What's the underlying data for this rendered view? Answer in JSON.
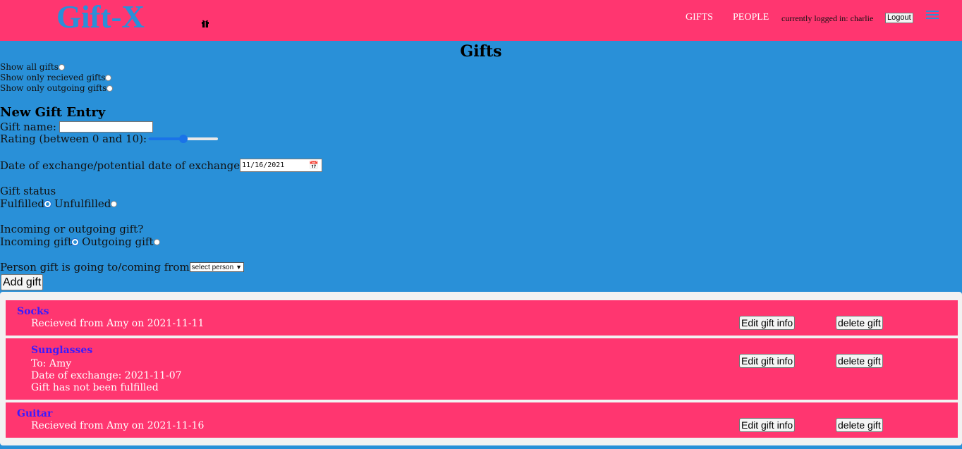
{
  "nav": {
    "brand": "Gift-X",
    "gifts_label": "GIFTS",
    "people_label": "PEOPLE",
    "login_text": "currently logged in: charlie",
    "logout_label": "Logout"
  },
  "page_title": "Gifts",
  "filters": {
    "all": "Show all gifts",
    "received": "Show only recieved gifts",
    "outgoing": "Show only outgoing gifts"
  },
  "form": {
    "title": "New Gift Entry",
    "gift_name_label": "Gift name:",
    "gift_name_value": "",
    "rating_label": "Rating (between 0 and 10):",
    "rating_value": 5,
    "rating_max": 10,
    "date_label": "Date of exchange/potential date of exchange",
    "date_value": "11/16/2021",
    "status_label": "Gift status",
    "fulfilled_label": "Fulfilled",
    "unfulfilled_label": "Unfulfilled",
    "direction_label": "Incoming or outgoing gift?",
    "incoming_label": "Incoming gift",
    "outgoing_label": "Outgoing gift",
    "person_label": "Person gift is going to/coming from",
    "person_select": "select person",
    "add_label": "Add gift"
  },
  "gifts": [
    {
      "name": "Socks",
      "line1": "Recieved from Amy on 2021-11-11"
    },
    {
      "name": "Sunglasses",
      "line1": "To: Amy",
      "line2": "Date of exchange: 2021-11-07",
      "line3": "Gift has not been fulfilled"
    },
    {
      "name": "Guitar",
      "line1": "Recieved from Amy on 2021-11-16"
    }
  ],
  "card_buttons": {
    "edit": "Edit gift info",
    "delete": "delete gift"
  },
  "colors": {
    "navbar": "#ff3670",
    "background": "#2990d8",
    "gift_name": "#3a1bff"
  },
  "icons": {
    "gift": "gift-icon",
    "menu": "hamburger-menu-icon",
    "calendar": "calendar-icon"
  }
}
